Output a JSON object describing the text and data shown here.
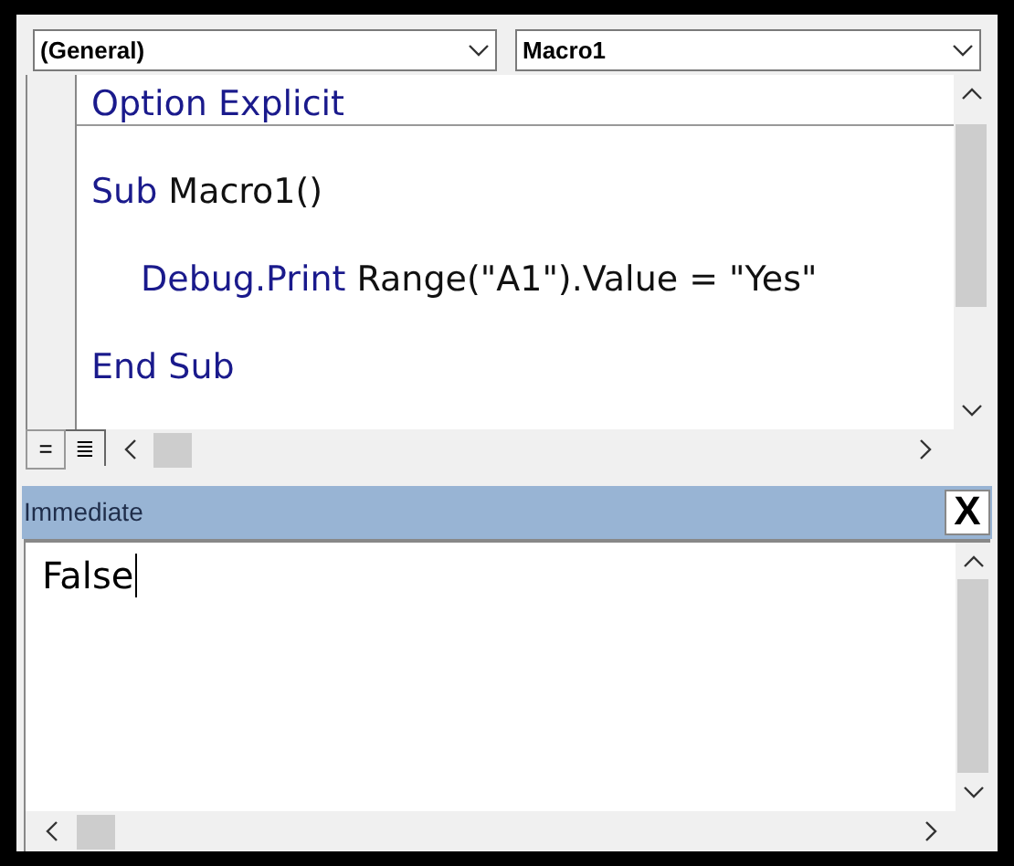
{
  "procedure_bar": {
    "object_dropdown": "(General)",
    "procedure_dropdown": "Macro1"
  },
  "code_window": {
    "lines": [
      {
        "kind": "declaration",
        "indented": false,
        "tokens": [
          {
            "text": "Option Explicit",
            "kind": "keyword"
          }
        ]
      },
      {
        "kind": "code",
        "indented": false,
        "tokens": [
          {
            "text": "Sub",
            "kind": "keyword"
          },
          {
            "text": "Macro1()",
            "kind": "plain"
          }
        ]
      },
      {
        "kind": "code",
        "indented": true,
        "tokens": [
          {
            "text": "Debug.Print",
            "kind": "keyword"
          },
          {
            "text": "Range(\"A1\").Value = \"Yes\"",
            "kind": "plain"
          }
        ]
      },
      {
        "kind": "code",
        "indented": false,
        "tokens": [
          {
            "text": "End Sub",
            "kind": "keyword"
          }
        ]
      }
    ],
    "view_buttons": [
      {
        "label": "=",
        "selected": false
      },
      {
        "label": "≣",
        "selected": true
      }
    ]
  },
  "immediate": {
    "title": "Immediate",
    "close": "X",
    "text": "False"
  }
}
